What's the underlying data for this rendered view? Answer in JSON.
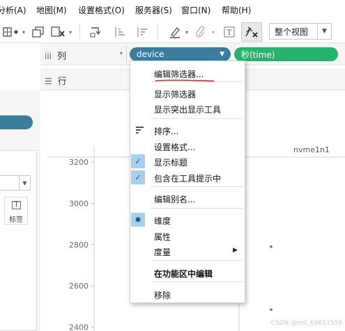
{
  "menubar": {
    "items": [
      "分析(A)",
      "地图(M)",
      "设置格式(O)",
      "服务器(S)",
      "窗口(N)",
      "帮助(H)"
    ]
  },
  "toolbar": {
    "view_select": "整个视图"
  },
  "shelves": {
    "columns_label": "列",
    "rows_label": "行",
    "columns_pills": [
      "device",
      "秒(time)"
    ]
  },
  "left_panel": {
    "label_button": "标签"
  },
  "chart": {
    "facet_header": "nvme1n1",
    "y_ticks": [
      "3200",
      "3000",
      "2800",
      "2600",
      "2400"
    ]
  },
  "chart_data": {
    "type": "scatter",
    "facet": "nvme1n1",
    "y_ticks": [
      3200,
      3000,
      2800,
      2600,
      2400
    ],
    "ylim": [
      2370,
      3300
    ],
    "points": [
      {
        "y": 2790
      },
      {
        "y": 2485
      }
    ]
  },
  "context_menu": {
    "items": [
      {
        "label": "编辑筛选器...",
        "checked": false
      },
      {
        "label": "显示筛选器",
        "checked": false
      },
      {
        "label": "显示突出显示工具",
        "checked": false
      },
      {
        "label": "排序...",
        "checked": false
      },
      {
        "label": "设置格式...",
        "checked": false
      },
      {
        "label": "显示标题",
        "checked": true
      },
      {
        "label": "包含在工具提示中",
        "checked": true
      },
      {
        "label": "编辑别名...",
        "checked": false
      },
      {
        "label": "维度",
        "checked": true
      },
      {
        "label": "属性",
        "checked": false
      },
      {
        "label": "度量",
        "checked": false
      },
      {
        "label": "在功能区中编辑",
        "checked": false
      },
      {
        "label": "移除",
        "checked": false
      }
    ]
  },
  "colors": {
    "device_pill": "#3c7d9e",
    "time_pill": "#26b46c",
    "check_bg": "#a9cfee",
    "underline": "#e02020"
  },
  "watermark": "CSDN @m0_69657559"
}
